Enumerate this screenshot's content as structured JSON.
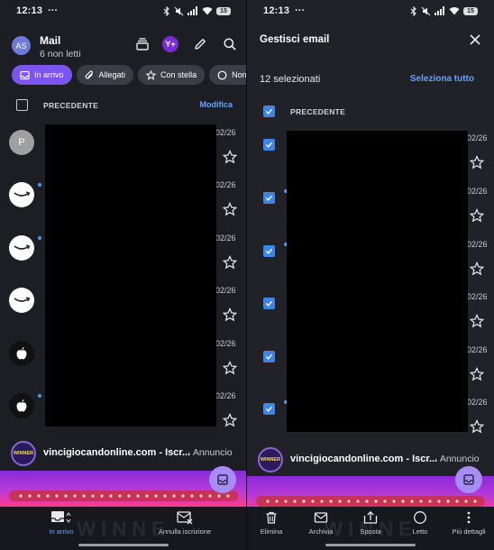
{
  "status": {
    "time": "12:13",
    "dots": "···",
    "battery": "15"
  },
  "left": {
    "avatar_initials": "AS",
    "title": "Mail",
    "unread": "6 non letti",
    "yplus_label": "Y+",
    "chips": [
      {
        "label": "In arrivo",
        "icon": "inbox-icon",
        "active": true
      },
      {
        "label": "Allegati",
        "icon": "paperclip-icon",
        "active": false
      },
      {
        "label": "Con stella",
        "icon": "star-icon",
        "active": false
      },
      {
        "label": "Non l",
        "icon": "circle-icon",
        "active": false
      }
    ],
    "section_label": "PRECEDENTE",
    "edit_label": "Modifica",
    "emails": [
      {
        "sender_icon": "letter-p",
        "sender_letter": "P",
        "date": "02/26",
        "unread": false
      },
      {
        "sender_icon": "amazon-icon",
        "sender_letter": "",
        "date": "02/26",
        "unread": true
      },
      {
        "sender_icon": "amazon-icon",
        "sender_letter": "",
        "date": "02/26",
        "unread": true
      },
      {
        "sender_icon": "amazon-icon",
        "sender_letter": "",
        "date": "02/26",
        "unread": false
      },
      {
        "sender_icon": "apple-icon",
        "sender_letter": "",
        "date": "02/26",
        "unread": false
      },
      {
        "sender_icon": "apple-icon",
        "sender_letter": "",
        "date": "02/26",
        "unread": true
      }
    ],
    "ad": {
      "badge": "WINNER",
      "text": "vincigiocandonline.com - Iscr...",
      "tag": "· Annuncio"
    },
    "banner_ghost": "WINNE",
    "bottom_nav": [
      {
        "label": "In arrivo",
        "icon": "inbox-icon",
        "active": true
      },
      {
        "label": "Annulla iscrizione",
        "icon": "unsubscribe-icon",
        "active": false
      }
    ]
  },
  "right": {
    "title": "Gestisci email",
    "selected_count": "12 selezionati",
    "select_all": "Seleziona tutto",
    "section_label": "PRECEDENTE",
    "emails": [
      {
        "date": "02/26",
        "checked": true,
        "unread": false
      },
      {
        "date": "02/26",
        "checked": true,
        "unread": true
      },
      {
        "date": "02/26",
        "checked": true,
        "unread": true
      },
      {
        "date": "02/26",
        "checked": true,
        "unread": false
      },
      {
        "date": "02/26",
        "checked": true,
        "unread": false
      },
      {
        "date": "02/26",
        "checked": true,
        "unread": true
      }
    ],
    "ad": {
      "badge": "WINNER",
      "text": "vincigiocandonline.com - Iscr...",
      "tag": "· Annuncio"
    },
    "banner_ghost": "WINNE",
    "actions": [
      {
        "label": "Elimina",
        "icon": "trash-icon"
      },
      {
        "label": "Archivia",
        "icon": "archive-icon"
      },
      {
        "label": "Sposta",
        "icon": "move-icon"
      },
      {
        "label": "Letto",
        "icon": "read-circle-icon"
      },
      {
        "label": "Più dettagli",
        "icon": "more-vertical-icon"
      }
    ]
  },
  "colors": {
    "accent": "#7c55f0",
    "link": "#6aa0ff",
    "checkbox": "#3b86e8",
    "unread_dot": "#4a9cf0",
    "background": "#1c1e24"
  }
}
